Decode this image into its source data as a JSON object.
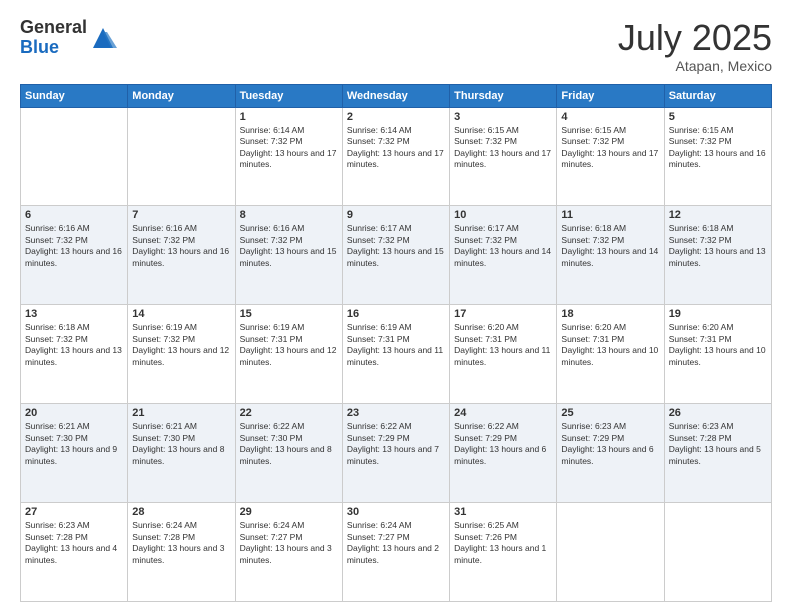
{
  "logo": {
    "general": "General",
    "blue": "Blue"
  },
  "title": "July 2025",
  "location": "Atapan, Mexico",
  "days_of_week": [
    "Sunday",
    "Monday",
    "Tuesday",
    "Wednesday",
    "Thursday",
    "Friday",
    "Saturday"
  ],
  "weeks": [
    [
      {
        "day": "",
        "info": ""
      },
      {
        "day": "",
        "info": ""
      },
      {
        "day": "1",
        "info": "Sunrise: 6:14 AM\nSunset: 7:32 PM\nDaylight: 13 hours and 17 minutes."
      },
      {
        "day": "2",
        "info": "Sunrise: 6:14 AM\nSunset: 7:32 PM\nDaylight: 13 hours and 17 minutes."
      },
      {
        "day": "3",
        "info": "Sunrise: 6:15 AM\nSunset: 7:32 PM\nDaylight: 13 hours and 17 minutes."
      },
      {
        "day": "4",
        "info": "Sunrise: 6:15 AM\nSunset: 7:32 PM\nDaylight: 13 hours and 17 minutes."
      },
      {
        "day": "5",
        "info": "Sunrise: 6:15 AM\nSunset: 7:32 PM\nDaylight: 13 hours and 16 minutes."
      }
    ],
    [
      {
        "day": "6",
        "info": "Sunrise: 6:16 AM\nSunset: 7:32 PM\nDaylight: 13 hours and 16 minutes."
      },
      {
        "day": "7",
        "info": "Sunrise: 6:16 AM\nSunset: 7:32 PM\nDaylight: 13 hours and 16 minutes."
      },
      {
        "day": "8",
        "info": "Sunrise: 6:16 AM\nSunset: 7:32 PM\nDaylight: 13 hours and 15 minutes."
      },
      {
        "day": "9",
        "info": "Sunrise: 6:17 AM\nSunset: 7:32 PM\nDaylight: 13 hours and 15 minutes."
      },
      {
        "day": "10",
        "info": "Sunrise: 6:17 AM\nSunset: 7:32 PM\nDaylight: 13 hours and 14 minutes."
      },
      {
        "day": "11",
        "info": "Sunrise: 6:18 AM\nSunset: 7:32 PM\nDaylight: 13 hours and 14 minutes."
      },
      {
        "day": "12",
        "info": "Sunrise: 6:18 AM\nSunset: 7:32 PM\nDaylight: 13 hours and 13 minutes."
      }
    ],
    [
      {
        "day": "13",
        "info": "Sunrise: 6:18 AM\nSunset: 7:32 PM\nDaylight: 13 hours and 13 minutes."
      },
      {
        "day": "14",
        "info": "Sunrise: 6:19 AM\nSunset: 7:32 PM\nDaylight: 13 hours and 12 minutes."
      },
      {
        "day": "15",
        "info": "Sunrise: 6:19 AM\nSunset: 7:31 PM\nDaylight: 13 hours and 12 minutes."
      },
      {
        "day": "16",
        "info": "Sunrise: 6:19 AM\nSunset: 7:31 PM\nDaylight: 13 hours and 11 minutes."
      },
      {
        "day": "17",
        "info": "Sunrise: 6:20 AM\nSunset: 7:31 PM\nDaylight: 13 hours and 11 minutes."
      },
      {
        "day": "18",
        "info": "Sunrise: 6:20 AM\nSunset: 7:31 PM\nDaylight: 13 hours and 10 minutes."
      },
      {
        "day": "19",
        "info": "Sunrise: 6:20 AM\nSunset: 7:31 PM\nDaylight: 13 hours and 10 minutes."
      }
    ],
    [
      {
        "day": "20",
        "info": "Sunrise: 6:21 AM\nSunset: 7:30 PM\nDaylight: 13 hours and 9 minutes."
      },
      {
        "day": "21",
        "info": "Sunrise: 6:21 AM\nSunset: 7:30 PM\nDaylight: 13 hours and 8 minutes."
      },
      {
        "day": "22",
        "info": "Sunrise: 6:22 AM\nSunset: 7:30 PM\nDaylight: 13 hours and 8 minutes."
      },
      {
        "day": "23",
        "info": "Sunrise: 6:22 AM\nSunset: 7:29 PM\nDaylight: 13 hours and 7 minutes."
      },
      {
        "day": "24",
        "info": "Sunrise: 6:22 AM\nSunset: 7:29 PM\nDaylight: 13 hours and 6 minutes."
      },
      {
        "day": "25",
        "info": "Sunrise: 6:23 AM\nSunset: 7:29 PM\nDaylight: 13 hours and 6 minutes."
      },
      {
        "day": "26",
        "info": "Sunrise: 6:23 AM\nSunset: 7:28 PM\nDaylight: 13 hours and 5 minutes."
      }
    ],
    [
      {
        "day": "27",
        "info": "Sunrise: 6:23 AM\nSunset: 7:28 PM\nDaylight: 13 hours and 4 minutes."
      },
      {
        "day": "28",
        "info": "Sunrise: 6:24 AM\nSunset: 7:28 PM\nDaylight: 13 hours and 3 minutes."
      },
      {
        "day": "29",
        "info": "Sunrise: 6:24 AM\nSunset: 7:27 PM\nDaylight: 13 hours and 3 minutes."
      },
      {
        "day": "30",
        "info": "Sunrise: 6:24 AM\nSunset: 7:27 PM\nDaylight: 13 hours and 2 minutes."
      },
      {
        "day": "31",
        "info": "Sunrise: 6:25 AM\nSunset: 7:26 PM\nDaylight: 13 hours and 1 minute."
      },
      {
        "day": "",
        "info": ""
      },
      {
        "day": "",
        "info": ""
      }
    ]
  ]
}
